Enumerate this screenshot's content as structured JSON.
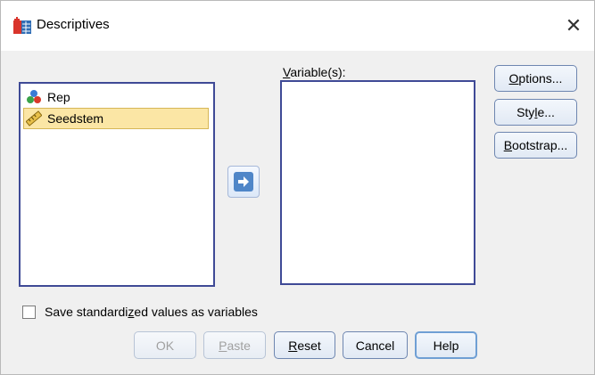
{
  "window": {
    "title": "Descriptives",
    "close_glyph": "✕"
  },
  "source_list": {
    "items": [
      {
        "label": "Rep",
        "icon": "nominal-variable-icon",
        "selected": false
      },
      {
        "label": "Seedstem",
        "icon": "scale-variable-icon",
        "selected": true
      }
    ]
  },
  "target_list": {
    "label_first": "V",
    "label_rest": "ariable(s):",
    "items": []
  },
  "move_button": {
    "icon": "arrow-right-icon"
  },
  "side_buttons": {
    "options": {
      "u": "O",
      "rest": "ptions..."
    },
    "style": {
      "pre": "Sty",
      "u": "l",
      "rest": "e..."
    },
    "bootstrap": {
      "u": "B",
      "rest": "ootstrap..."
    }
  },
  "checkbox": {
    "pre": "Save standardi",
    "u": "z",
    "rest": "ed values as variables",
    "checked": false
  },
  "bottom_buttons": {
    "ok": "OK",
    "paste": {
      "u": "P",
      "rest": "aste"
    },
    "reset": {
      "u": "R",
      "rest": "eset"
    },
    "cancel": "Cancel",
    "help": "Help"
  },
  "colors": {
    "listbox_border": "#3f4a96",
    "selection_bg": "#fbe6a5",
    "arrow_fill": "#4f86c8",
    "dialog_bg": "#f0f0f0"
  }
}
